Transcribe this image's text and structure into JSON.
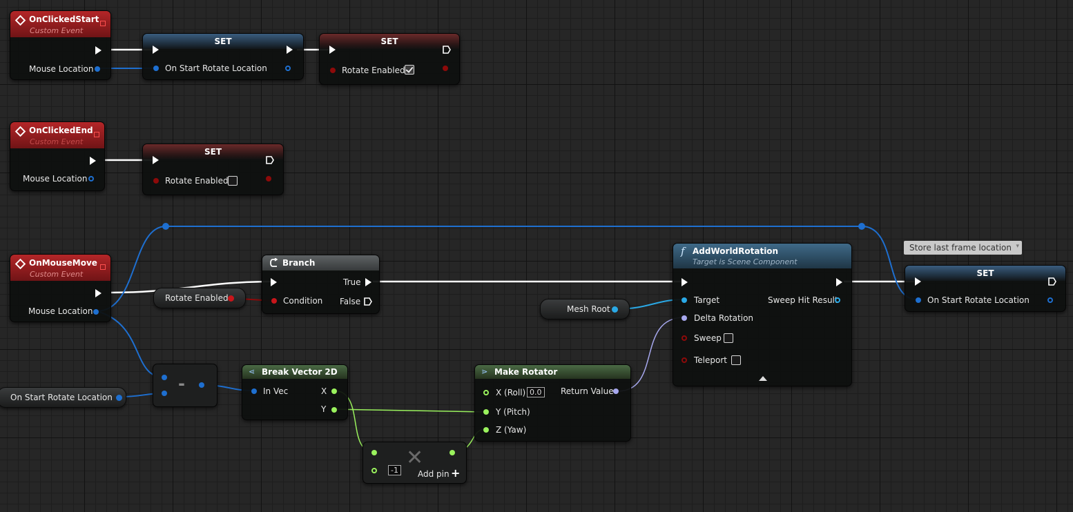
{
  "nodes": {
    "clicked_start": {
      "title": "OnClickedStart",
      "subtitle": "Custom Event",
      "pin": "Mouse Location"
    },
    "set_start_rot": {
      "title": "SET",
      "pin": "On Start Rotate Location"
    },
    "set_rotate_true": {
      "title": "SET",
      "pin": "Rotate Enabled",
      "checked": true
    },
    "clicked_end": {
      "title": "OnClickedEnd",
      "subtitle": "Custom Event",
      "pin": "Mouse Location"
    },
    "set_rotate_false": {
      "title": "SET",
      "pin": "Rotate Enabled",
      "checked": false
    },
    "mouse_move": {
      "title": "OnMouseMove",
      "subtitle": "Custom Event",
      "pin": "Mouse Location"
    },
    "rotate_enabled_var": {
      "label": "Rotate Enabled"
    },
    "branch": {
      "title": "Branch",
      "true_label": "True",
      "false_label": "False",
      "condition_label": "Condition"
    },
    "add_world_rotation": {
      "title": "AddWorldRotation",
      "subtitle": "Target is Scene Component",
      "target": "Target",
      "delta": "Delta Rotation",
      "sweep": "Sweep",
      "teleport": "Teleport",
      "sweep_hit": "Sweep Hit Result"
    },
    "mesh_root_var": {
      "label": "Mesh Root"
    },
    "comment": {
      "text": "Store last frame location"
    },
    "set_last": {
      "title": "SET",
      "pin": "On Start Rotate Location"
    },
    "start_rot_var": {
      "label": "On Start Rotate Location"
    },
    "subtract": {
      "symbol": "-"
    },
    "break_vector": {
      "title": "Break Vector 2D",
      "in": "In Vec",
      "x": "X",
      "y": "Y"
    },
    "make_rotator": {
      "title": "Make Rotator",
      "roll": "X (Roll)",
      "roll_value": "0.0",
      "pitch": "Y (Pitch)",
      "yaw": "Z (Yaw)",
      "ret": "Return Value"
    },
    "multiply": {
      "value": "-1",
      "add_pin": "Add pin"
    }
  },
  "colors": {
    "exec": "#ffffff",
    "vector2d": "#1e6fd0",
    "bool": "#8d0a0a",
    "float": "#9af25d",
    "rotator": "#a7a8ee",
    "object": "#2aa9e6",
    "event_header": "#b42628"
  },
  "icons": [
    "event-diamond-icon",
    "branch-icon",
    "function-icon",
    "break-icon",
    "make-icon",
    "multiply-x-icon",
    "add-pin-plus-icon",
    "comment-collapse-icon"
  ]
}
